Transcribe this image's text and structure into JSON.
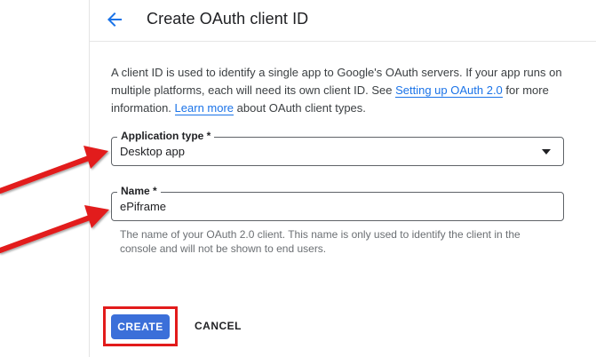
{
  "header": {
    "back_icon": "arrow-back-icon",
    "title": "Create OAuth client ID"
  },
  "intro": {
    "text_1": "A client ID is used to identify a single app to Google's OAuth servers. If your app runs on multiple platforms, each will need its own client ID. See ",
    "link_setup": "Setting up OAuth 2.0",
    "text_2": " for more information. ",
    "link_learn": "Learn more",
    "text_3": " about OAuth client types."
  },
  "form": {
    "application_type": {
      "label": "Application type *",
      "value": "Desktop app",
      "icon": "dropdown-caret-icon"
    },
    "name": {
      "label": "Name *",
      "value": "ePiframe",
      "hint": "The name of your OAuth 2.0 client. This name is only used to identify the client in the console and will not be shown to end users."
    }
  },
  "actions": {
    "create_label": "CREATE",
    "cancel_label": "CANCEL"
  },
  "colors": {
    "accent": "#1a73e8",
    "primary_button": "#3b6fd9",
    "annotation": "#e21b1b"
  }
}
